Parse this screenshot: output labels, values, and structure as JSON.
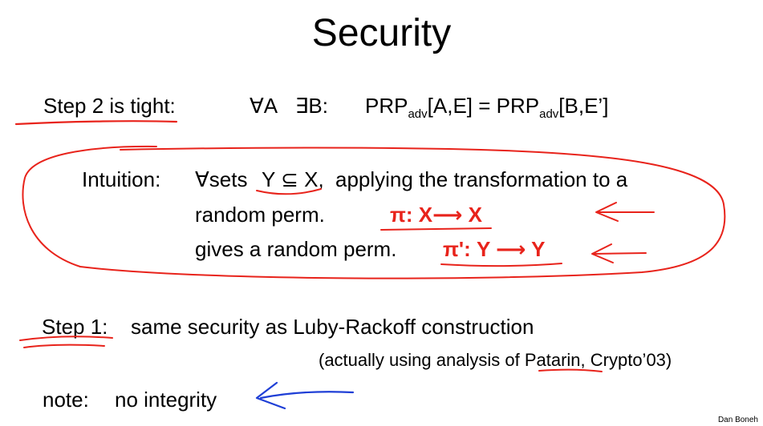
{
  "title": "Security",
  "step2": {
    "label": "Step 2 is tight:",
    "forall_a": "∀A",
    "exists_b": "∃B:",
    "eq": {
      "lhs_prefix": "PRP",
      "lhs_sub": "adv",
      "lhs_args": "[A,E] = PRP",
      "rhs_sub": "adv",
      "rhs_args": "[B,E’]"
    }
  },
  "intuition": {
    "label": "Intuition:",
    "text1_prefix": "∀sets",
    "sets": "Y ⊆ X,",
    "text1_suffix": "applying the transformation to a",
    "text2": "random perm.",
    "perm1": "π: X⟶ X",
    "text3": "gives a random perm.",
    "perm2": "π': Y ⟶ Y"
  },
  "step1": {
    "label": "Step 1:",
    "text": "same security as Luby-Rackoff construction",
    "note_prefix": "(actually using analysis of",
    "note_name": "Patarin",
    "note_suffix": ", Crypto’03)"
  },
  "note": {
    "label": "note:",
    "text": "no integrity"
  },
  "credit": "Dan Boneh",
  "colors": {
    "ink_red": "#e8231b",
    "ink_blue": "#1f3fd6",
    "text": "#000000",
    "background": "#ffffff"
  }
}
